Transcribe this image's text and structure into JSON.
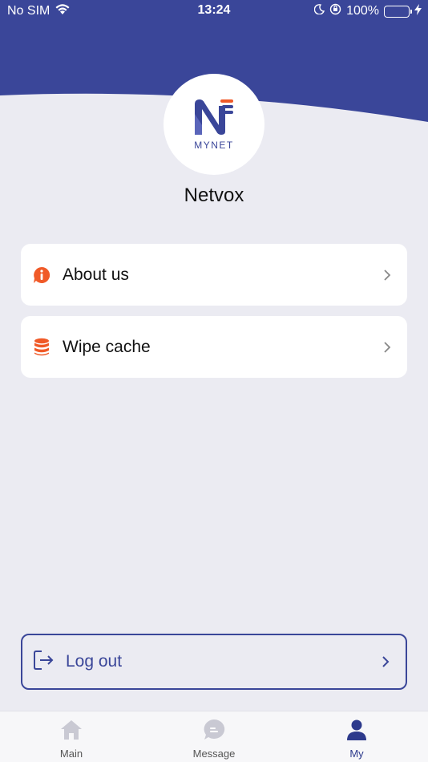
{
  "status_bar": {
    "carrier": "No SIM",
    "time": "13:24",
    "battery_percent": "100%",
    "battery_level": 1.0
  },
  "profile": {
    "logo_text": "MYNET",
    "name": "Netvox"
  },
  "menu": [
    {
      "label": "About us",
      "icon": "info-bubble-icon"
    },
    {
      "label": "Wipe cache",
      "icon": "database-icon"
    }
  ],
  "logout": {
    "label": "Log out",
    "icon": "logout-icon"
  },
  "tabs": [
    {
      "label": "Main",
      "icon": "home-icon",
      "active": false
    },
    {
      "label": "Message",
      "icon": "message-icon",
      "active": false
    },
    {
      "label": "My",
      "icon": "user-icon",
      "active": true
    }
  ],
  "colors": {
    "brand": "#3a4699",
    "accent": "#f05a28",
    "background": "#ebebf2",
    "battery": "#4cd964"
  }
}
